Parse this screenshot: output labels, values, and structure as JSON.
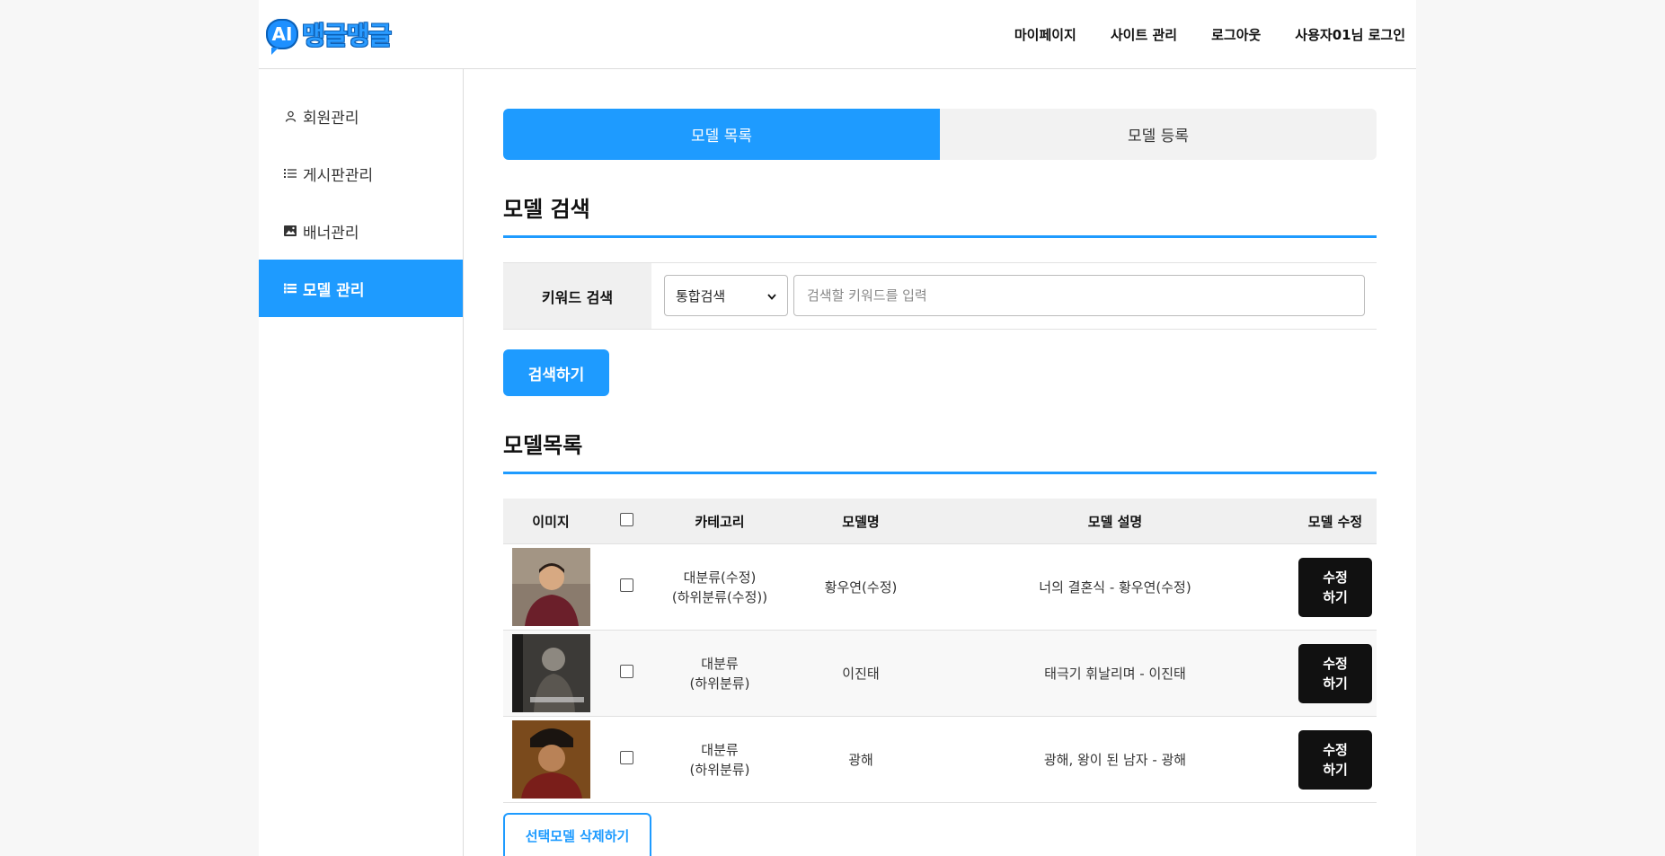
{
  "header": {
    "logo_badge": "AI",
    "logo_text": "맹글맹글",
    "nav": [
      "마이페이지",
      "사이트 관리",
      "로그아웃",
      "사용자01님 로그인"
    ]
  },
  "sidebar": {
    "items": [
      {
        "label": "회원관리",
        "icon": "user-icon"
      },
      {
        "label": "게시판관리",
        "icon": "list-icon"
      },
      {
        "label": "배너관리",
        "icon": "image-icon"
      },
      {
        "label": "모델 관리",
        "icon": "list-icon",
        "active": true
      }
    ]
  },
  "tabs": [
    {
      "label": "모델 목록",
      "active": true
    },
    {
      "label": "모델 등록",
      "active": false
    }
  ],
  "search": {
    "title": "모델 검색",
    "label": "키워드 검색",
    "select_value": "통합검색",
    "placeholder": "검색할 키워드를 입력",
    "button": "검색하기"
  },
  "list": {
    "title": "모델목록",
    "headers": [
      "이미지",
      "",
      "카테고리",
      "모델명",
      "모델 설명",
      "모델 수정"
    ],
    "rows": [
      {
        "cat1": "대분류(수정)",
        "cat2": "(하위분류(수정))",
        "name": "황우연(수정)",
        "desc": "너의 결혼식 - 황우연(수정)",
        "edit1": "수정",
        "edit2": "하기"
      },
      {
        "cat1": "대분류",
        "cat2": "(하위분류)",
        "name": "이진태",
        "desc": "태극기 휘날리며 - 이진태",
        "edit1": "수정",
        "edit2": "하기"
      },
      {
        "cat1": "대분류",
        "cat2": "(하위분류)",
        "name": "광해",
        "desc": "광해, 왕이 된 남자 - 광해",
        "edit1": "수정",
        "edit2": "하기"
      }
    ],
    "delete_button": "선택모델 삭제하기"
  },
  "colors": {
    "accent": "#1e9bff",
    "dark_button": "#111111"
  }
}
